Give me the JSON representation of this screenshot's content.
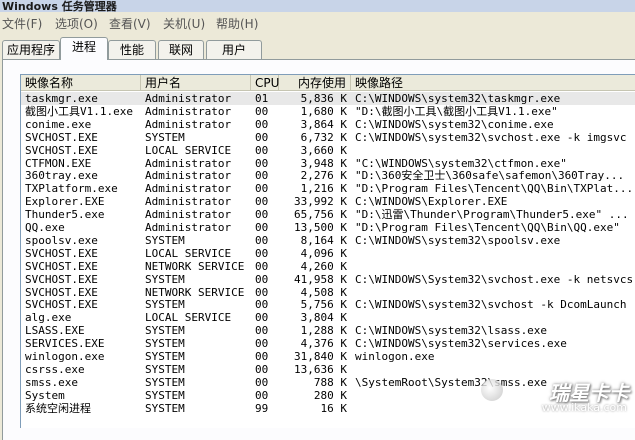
{
  "window": {
    "title": "Windows 任务管理器"
  },
  "menu": [
    {
      "label": "文件(F)"
    },
    {
      "label": "选项(O)"
    },
    {
      "label": "查看(V)"
    },
    {
      "label": "关机(U)"
    },
    {
      "label": "帮助(H)"
    }
  ],
  "tabs": [
    {
      "label": "应用程序"
    },
    {
      "label": "进程"
    },
    {
      "label": "性能"
    },
    {
      "label": "联网"
    },
    {
      "label": "用户"
    }
  ],
  "columns": {
    "name": "映像名称",
    "user": "用户名",
    "cpu": "CPU",
    "mem": "内存使用",
    "path": "映像路径"
  },
  "processes": [
    {
      "name": "taskmgr.exe",
      "user": "Administrator",
      "cpu": "01",
      "mem": "5,836 K",
      "path": "C:\\WINDOWS\\system32\\taskmgr.exe"
    },
    {
      "name": "截图小工具V1.1.exe",
      "user": "Administrator",
      "cpu": "00",
      "mem": "1,680 K",
      "path": "\"D:\\截图小工具\\截图小工具V1.1.exe\""
    },
    {
      "name": "conime.exe",
      "user": "Administrator",
      "cpu": "00",
      "mem": "3,864 K",
      "path": "C:\\WINDOWS\\system32\\conime.exe"
    },
    {
      "name": "SVCHOST.EXE",
      "user": "SYSTEM",
      "cpu": "00",
      "mem": "6,732 K",
      "path": "C:\\WINDOWS\\system32\\svchost.exe -k imgsvc"
    },
    {
      "name": "SVCHOST.EXE",
      "user": "LOCAL SERVICE",
      "cpu": "00",
      "mem": "3,660 K",
      "path": ""
    },
    {
      "name": "CTFMON.EXE",
      "user": "Administrator",
      "cpu": "00",
      "mem": "3,948 K",
      "path": "\"C:\\WINDOWS\\system32\\ctfmon.exe\""
    },
    {
      "name": "360tray.exe",
      "user": "Administrator",
      "cpu": "00",
      "mem": "2,276 K",
      "path": "\"D:\\360安全卫士\\360safe\\safemon\\360Tray..."
    },
    {
      "name": "TXPlatform.exe",
      "user": "Administrator",
      "cpu": "00",
      "mem": "1,216 K",
      "path": "\"D:\\Program Files\\Tencent\\QQ\\Bin\\TXPlat..."
    },
    {
      "name": "Explorer.EXE",
      "user": "Administrator",
      "cpu": "00",
      "mem": "33,992 K",
      "path": "C:\\WINDOWS\\Explorer.EXE"
    },
    {
      "name": "Thunder5.exe",
      "user": "Administrator",
      "cpu": "00",
      "mem": "65,756 K",
      "path": "\"D:\\迅雷\\Thunder\\Program\\Thunder5.exe\" ..."
    },
    {
      "name": "QQ.exe",
      "user": "Administrator",
      "cpu": "00",
      "mem": "13,500 K",
      "path": "\"D:\\Program Files\\Tencent\\QQ\\Bin\\QQ.exe\""
    },
    {
      "name": "spoolsv.exe",
      "user": "SYSTEM",
      "cpu": "00",
      "mem": "8,164 K",
      "path": "C:\\WINDOWS\\system32\\spoolsv.exe"
    },
    {
      "name": "SVCHOST.EXE",
      "user": "LOCAL SERVICE",
      "cpu": "00",
      "mem": "4,096 K",
      "path": ""
    },
    {
      "name": "SVCHOST.EXE",
      "user": "NETWORK SERVICE",
      "cpu": "00",
      "mem": "4,260 K",
      "path": ""
    },
    {
      "name": "SVCHOST.EXE",
      "user": "SYSTEM",
      "cpu": "00",
      "mem": "41,958 K",
      "path": "C:\\WINDOWS\\System32\\svchost.exe -k netsvcs"
    },
    {
      "name": "SVCHOST.EXE",
      "user": "NETWORK SERVICE",
      "cpu": "00",
      "mem": "4,508 K",
      "path": ""
    },
    {
      "name": "SVCHOST.EXE",
      "user": "SYSTEM",
      "cpu": "00",
      "mem": "5,756 K",
      "path": "C:\\WINDOWS\\system32\\svchost -k DcomLaunch"
    },
    {
      "name": "alg.exe",
      "user": "LOCAL SERVICE",
      "cpu": "00",
      "mem": "3,804 K",
      "path": ""
    },
    {
      "name": "LSASS.EXE",
      "user": "SYSTEM",
      "cpu": "00",
      "mem": "1,288 K",
      "path": "C:\\WINDOWS\\system32\\lsass.exe"
    },
    {
      "name": "SERVICES.EXE",
      "user": "SYSTEM",
      "cpu": "00",
      "mem": "4,376 K",
      "path": "C:\\WINDOWS\\system32\\services.exe"
    },
    {
      "name": "winlogon.exe",
      "user": "SYSTEM",
      "cpu": "00",
      "mem": "31,840 K",
      "path": "winlogon.exe"
    },
    {
      "name": "csrss.exe",
      "user": "SYSTEM",
      "cpu": "00",
      "mem": "13,636 K",
      "path": ""
    },
    {
      "name": "smss.exe",
      "user": "SYSTEM",
      "cpu": "00",
      "mem": "788 K",
      "path": "\\SystemRoot\\System32\\smss.exe"
    },
    {
      "name": "System",
      "user": "SYSTEM",
      "cpu": "00",
      "mem": "280 K",
      "path": ""
    },
    {
      "name": "系统空闲进程",
      "user": "SYSTEM",
      "cpu": "99",
      "mem": "16 K",
      "path": ""
    }
  ],
  "watermark": {
    "logo": "瑞星卡卡",
    "url": "www.ikaka.com"
  }
}
